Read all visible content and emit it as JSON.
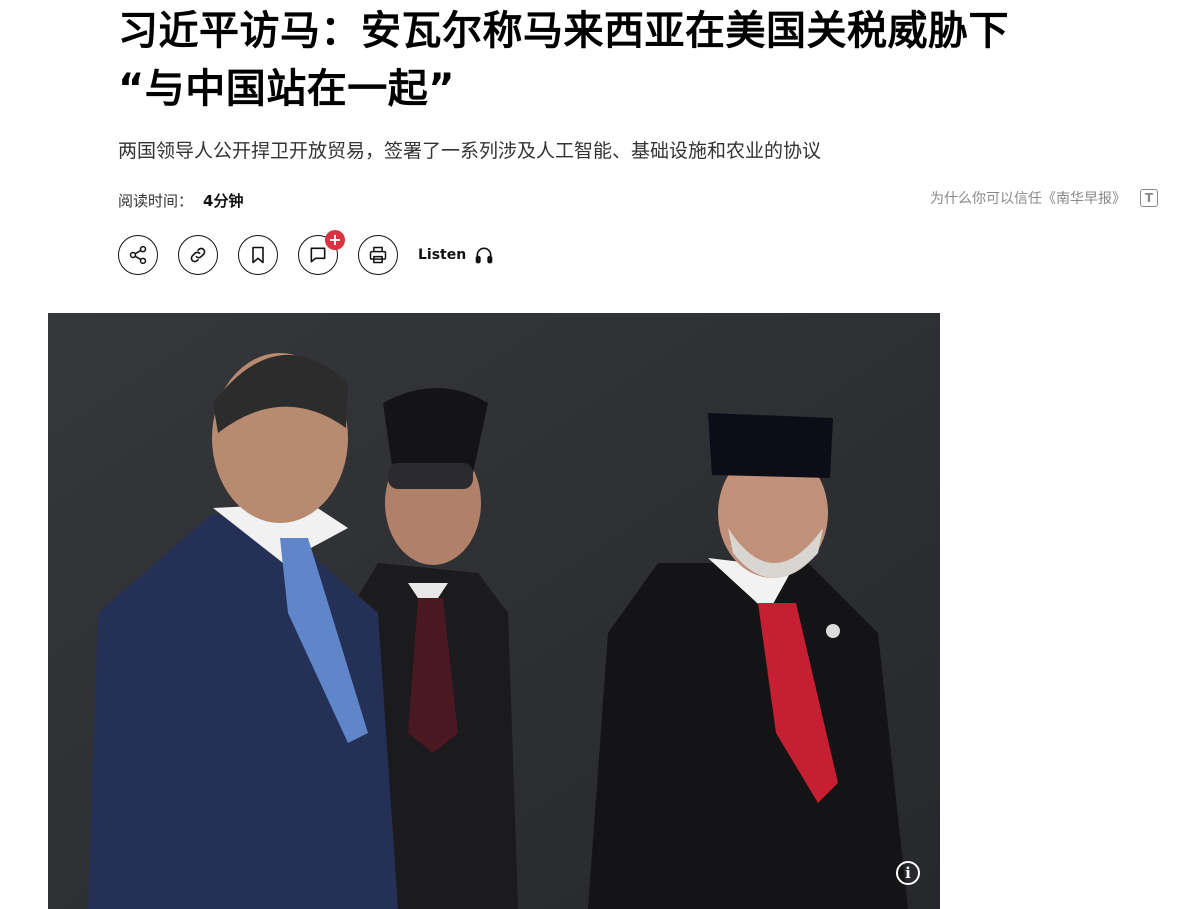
{
  "article": {
    "headline_line1": "习近平访马：安瓦尔称马来西亚在美国关税威胁下",
    "headline_line2": "“与中国站在一起”",
    "subheadline": "两国领导人公开捍卫开放贸易，签署了一系列涉及人工智能、基础设施和农业的协议",
    "read_time_label": "阅读时间：",
    "read_time_value": "4分钟",
    "trust_link": "为什么你可以信任《南华早报》",
    "trust_icon_glyph": "T"
  },
  "actions": {
    "share": "share-icon",
    "copy_link": "link-icon",
    "bookmark": "bookmark-icon",
    "comment": "comment-icon",
    "comment_badge": "+",
    "print": "print-icon",
    "listen_label": "Listen",
    "listen_icon": "headphones-icon"
  },
  "photo": {
    "info_glyph": "i"
  },
  "colors": {
    "badge_red": "#d8313f",
    "muted_gray": "#888888",
    "photo_background": "#2e3034"
  }
}
